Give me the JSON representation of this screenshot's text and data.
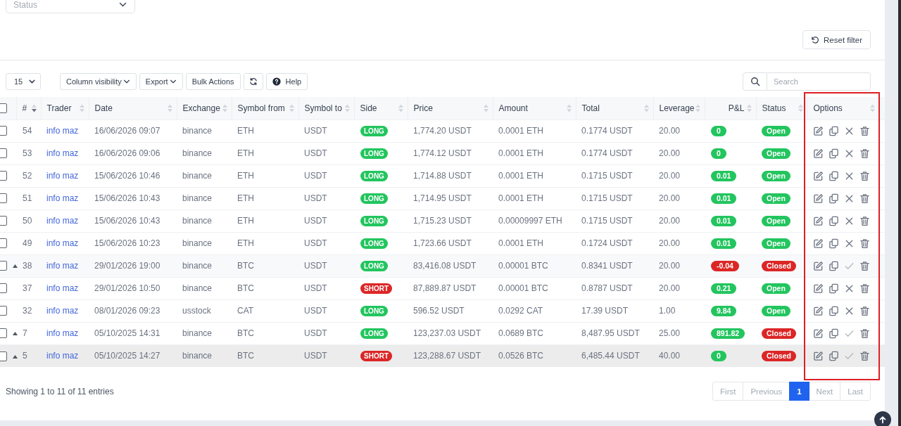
{
  "filters": {
    "status": {
      "placeholder": "Status"
    }
  },
  "reset_button": {
    "label": "Reset filter"
  },
  "toolbar": {
    "page_length": {
      "value": "15"
    },
    "buttons": [
      {
        "kind": "dropdown",
        "label": "Column visibility"
      },
      {
        "kind": "dropdown",
        "label": "Export"
      },
      {
        "kind": "plain",
        "label": "Bulk Actions"
      },
      {
        "kind": "refresh"
      },
      {
        "kind": "help",
        "label": "Help"
      }
    ],
    "search": {
      "placeholder": "Search"
    }
  },
  "table": {
    "select_all": {
      "checked": false
    },
    "columns": [
      {
        "label": "#",
        "sort_desc": true,
        "highlighted": false
      },
      {
        "label": "Trader",
        "sort_desc": false,
        "highlighted": false
      },
      {
        "label": "Date",
        "sort_desc": false,
        "highlighted": false
      },
      {
        "label": "Exchange",
        "sort_desc": false,
        "highlighted": false
      },
      {
        "label": "Symbol from",
        "sort_desc": false,
        "highlighted": false
      },
      {
        "label": "Symbol to",
        "sort_desc": false,
        "highlighted": false
      },
      {
        "label": "Side",
        "sort_desc": false,
        "highlighted": false
      },
      {
        "label": "Price",
        "sort_desc": false,
        "highlighted": false
      },
      {
        "label": "Amount",
        "sort_desc": false,
        "highlighted": false
      },
      {
        "label": "Total",
        "sort_desc": false,
        "highlighted": false
      },
      {
        "label": "Leverage",
        "sort_desc": false,
        "highlighted": false
      },
      {
        "label": "P&L",
        "sort_desc": false,
        "highlighted": false
      },
      {
        "label": "Status",
        "sort_desc": false,
        "highlighted": false
      },
      {
        "label": "Options",
        "sort_desc": false,
        "highlighted": true
      }
    ],
    "rows": [
      {
        "checked": false,
        "expandable": false,
        "shaded": false,
        "hovered": false,
        "number": "54",
        "trader": "info maz",
        "date": "16/06/2026 09:07",
        "exchange": "binance",
        "symbol_from": "ETH",
        "symbol_to": "USDT",
        "side": {
          "label": "LONG",
          "color": "#22c55e"
        },
        "price": "1,774.20 USDT",
        "amount": "0.0001 ETH",
        "total": "0.1774 USDT",
        "leverage": "20.00",
        "pnl": {
          "label": "0",
          "color": "#22c55e"
        },
        "status": {
          "label": "Open",
          "color": "#22c55e"
        },
        "closed": false
      },
      {
        "checked": false,
        "expandable": false,
        "shaded": false,
        "hovered": false,
        "number": "53",
        "trader": "info maz",
        "date": "16/06/2026 09:06",
        "exchange": "binance",
        "symbol_from": "ETH",
        "symbol_to": "USDT",
        "side": {
          "label": "LONG",
          "color": "#22c55e"
        },
        "price": "1,774.12 USDT",
        "amount": "0.0001 ETH",
        "total": "0.1774 USDT",
        "leverage": "20.00",
        "pnl": {
          "label": "0",
          "color": "#22c55e"
        },
        "status": {
          "label": "Open",
          "color": "#22c55e"
        },
        "closed": false
      },
      {
        "checked": false,
        "expandable": false,
        "shaded": false,
        "hovered": false,
        "number": "52",
        "trader": "info maz",
        "date": "15/06/2026 10:46",
        "exchange": "binance",
        "symbol_from": "ETH",
        "symbol_to": "USDT",
        "side": {
          "label": "LONG",
          "color": "#22c55e"
        },
        "price": "1,714.88 USDT",
        "amount": "0.0001 ETH",
        "total": "0.1715 USDT",
        "leverage": "20.00",
        "pnl": {
          "label": "0.01",
          "color": "#22c55e"
        },
        "status": {
          "label": "Open",
          "color": "#22c55e"
        },
        "closed": false
      },
      {
        "checked": false,
        "expandable": false,
        "shaded": false,
        "hovered": false,
        "number": "51",
        "trader": "info maz",
        "date": "15/06/2026 10:43",
        "exchange": "binance",
        "symbol_from": "ETH",
        "symbol_to": "USDT",
        "side": {
          "label": "LONG",
          "color": "#22c55e"
        },
        "price": "1,714.95 USDT",
        "amount": "0.0001 ETH",
        "total": "0.1715 USDT",
        "leverage": "20.00",
        "pnl": {
          "label": "0.01",
          "color": "#22c55e"
        },
        "status": {
          "label": "Open",
          "color": "#22c55e"
        },
        "closed": false
      },
      {
        "checked": false,
        "expandable": false,
        "shaded": false,
        "hovered": false,
        "number": "50",
        "trader": "info maz",
        "date": "15/06/2026 10:43",
        "exchange": "binance",
        "symbol_from": "ETH",
        "symbol_to": "USDT",
        "side": {
          "label": "LONG",
          "color": "#22c55e"
        },
        "price": "1,715.23 USDT",
        "amount": "0.00009997 ETH",
        "total": "0.1715 USDT",
        "leverage": "20.00",
        "pnl": {
          "label": "0.01",
          "color": "#22c55e"
        },
        "status": {
          "label": "Open",
          "color": "#22c55e"
        },
        "closed": false
      },
      {
        "checked": false,
        "expandable": false,
        "shaded": false,
        "hovered": false,
        "number": "49",
        "trader": "info maz",
        "date": "15/06/2026 10:23",
        "exchange": "binance",
        "symbol_from": "ETH",
        "symbol_to": "USDT",
        "side": {
          "label": "LONG",
          "color": "#22c55e"
        },
        "price": "1,723.66 USDT",
        "amount": "0.0001 ETH",
        "total": "0.1724 USDT",
        "leverage": "20.00",
        "pnl": {
          "label": "0.01",
          "color": "#22c55e"
        },
        "status": {
          "label": "Open",
          "color": "#22c55e"
        },
        "closed": false
      },
      {
        "checked": false,
        "expandable": true,
        "shaded": true,
        "hovered": false,
        "number": "38",
        "trader": "info maz",
        "date": "29/01/2026 19:00",
        "exchange": "binance",
        "symbol_from": "BTC",
        "symbol_to": "USDT",
        "side": {
          "label": "LONG",
          "color": "#22c55e"
        },
        "price": "83,416.08 USDT",
        "amount": "0.00001 BTC",
        "total": "0.8341 USDT",
        "leverage": "20.00",
        "pnl": {
          "label": "-0.04",
          "color": "#dc2626"
        },
        "status": {
          "label": "Closed",
          "color": "#dc2626"
        },
        "closed": true
      },
      {
        "checked": false,
        "expandable": false,
        "shaded": false,
        "hovered": false,
        "number": "37",
        "trader": "info maz",
        "date": "29/01/2026 10:50",
        "exchange": "binance",
        "symbol_from": "BTC",
        "symbol_to": "USDT",
        "side": {
          "label": "SHORT",
          "color": "#dc2626"
        },
        "price": "87,889.87 USDT",
        "amount": "0.00001 BTC",
        "total": "0.8787 USDT",
        "leverage": "20.00",
        "pnl": {
          "label": "0.21",
          "color": "#22c55e"
        },
        "status": {
          "label": "Open",
          "color": "#22c55e"
        },
        "closed": false
      },
      {
        "checked": false,
        "expandable": false,
        "shaded": false,
        "hovered": false,
        "number": "32",
        "trader": "info maz",
        "date": "08/01/2026 09:23",
        "exchange": "usstock",
        "symbol_from": "CAT",
        "symbol_to": "USDT",
        "side": {
          "label": "LONG",
          "color": "#22c55e"
        },
        "price": "596.52 USDT",
        "amount": "0.0292 CAT",
        "total": "17.39 USDT",
        "leverage": "1.00",
        "pnl": {
          "label": "9.84",
          "color": "#22c55e"
        },
        "status": {
          "label": "Open",
          "color": "#22c55e"
        },
        "closed": false
      },
      {
        "checked": false,
        "expandable": true,
        "shaded": false,
        "hovered": false,
        "number": "7",
        "trader": "info maz",
        "date": "05/10/2025 14:31",
        "exchange": "binance",
        "symbol_from": "BTC",
        "symbol_to": "USDT",
        "side": {
          "label": "LONG",
          "color": "#22c55e"
        },
        "price": "123,237.03 USDT",
        "amount": "0.0689 BTC",
        "total": "8,487.95 USDT",
        "leverage": "25.00",
        "pnl": {
          "label": "891.82",
          "color": "#22c55e"
        },
        "status": {
          "label": "Closed",
          "color": "#dc2626"
        },
        "closed": true
      },
      {
        "checked": false,
        "expandable": true,
        "shaded": false,
        "hovered": true,
        "number": "5",
        "trader": "info maz",
        "date": "05/10/2025 14:27",
        "exchange": "binance",
        "symbol_from": "BTC",
        "symbol_to": "USDT",
        "side": {
          "label": "SHORT",
          "color": "#dc2626"
        },
        "price": "123,288.67 USDT",
        "amount": "0.0526 BTC",
        "total": "6,485.44 USDT",
        "leverage": "40.00",
        "pnl": {
          "label": "0",
          "color": "#22c55e"
        },
        "status": {
          "label": "Closed",
          "color": "#dc2626"
        },
        "closed": true
      }
    ]
  },
  "footer": {
    "info": "Showing 1 to 11 of 11 entries",
    "pagination": [
      {
        "label": "First",
        "selected": false,
        "disabled": true
      },
      {
        "label": "Previous",
        "selected": false,
        "disabled": true
      },
      {
        "label": "1",
        "selected": true,
        "disabled": false
      },
      {
        "label": "Next",
        "selected": false,
        "disabled": true
      },
      {
        "label": "Last",
        "selected": false,
        "disabled": true
      }
    ]
  }
}
